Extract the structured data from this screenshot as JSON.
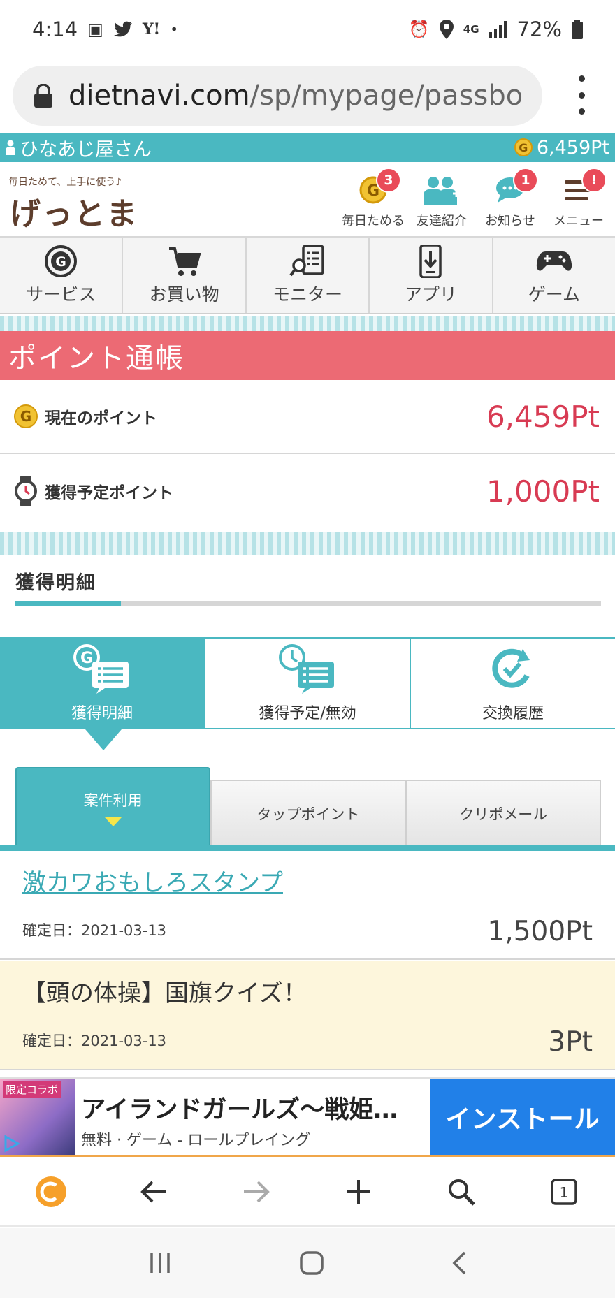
{
  "status_bar": {
    "time": "4:14",
    "network": "4G",
    "battery": "72%"
  },
  "browser": {
    "url_host": "dietnavi.com",
    "url_path": "/sp/mypage/passbo",
    "tab_count": "1"
  },
  "user_bar": {
    "username": "ひなあじ屋さん",
    "points": "6,459Pt"
  },
  "site": {
    "tagline": "毎日ためて、上手に使う♪",
    "logo": "げっとま",
    "header_nav": [
      {
        "label": "毎日ためる",
        "badge": "3"
      },
      {
        "label": "友達紹介",
        "badge": ""
      },
      {
        "label": "お知らせ",
        "badge": "1"
      },
      {
        "label": "メニュー",
        "badge": "!"
      }
    ]
  },
  "categories": [
    {
      "label": "サービス",
      "icon": "g-coin-icon"
    },
    {
      "label": "お買い物",
      "icon": "cart-icon"
    },
    {
      "label": "モニター",
      "icon": "monitor-icon"
    },
    {
      "label": "アプリ",
      "icon": "app-download-icon"
    },
    {
      "label": "ゲーム",
      "icon": "gamepad-icon"
    }
  ],
  "page_title": "ポイント通帳",
  "points_summary": {
    "current_label": "現在のポイント",
    "current_value": "6,459Pt",
    "pending_label": "獲得予定ポイント",
    "pending_value": "1,000Pt"
  },
  "details_section": {
    "heading": "獲得明細",
    "progress": 0.18
  },
  "main_tabs": [
    {
      "label": "獲得明細",
      "active": true
    },
    {
      "label": "獲得予定/無効",
      "active": false
    },
    {
      "label": "交換履歴",
      "active": false
    }
  ],
  "sub_tabs": [
    {
      "label": "案件利用",
      "active": true
    },
    {
      "label": "タップポイント",
      "active": false
    },
    {
      "label": "クリポメール",
      "active": false
    }
  ],
  "entries": [
    {
      "title": "激カワおもしろスタンプ",
      "date": "確定日：2021-03-13",
      "points": "1,500Pt",
      "link": true
    },
    {
      "title": "【頭の体操】国旗クイズ！",
      "date": "確定日：2021-03-13",
      "points": "3Pt",
      "link": false
    }
  ],
  "ad": {
    "badge": "限定コラボ",
    "title": "アイランドガールズ〜戦姫…",
    "subtitle": "無料 · ゲーム - ロールプレイング",
    "button": "インストール"
  },
  "colors": {
    "teal": "#4ab8c1",
    "title_red": "#ec6a74",
    "point_red": "#d83b53",
    "badge_red": "#e94b59",
    "install_blue": "#2180e8"
  }
}
